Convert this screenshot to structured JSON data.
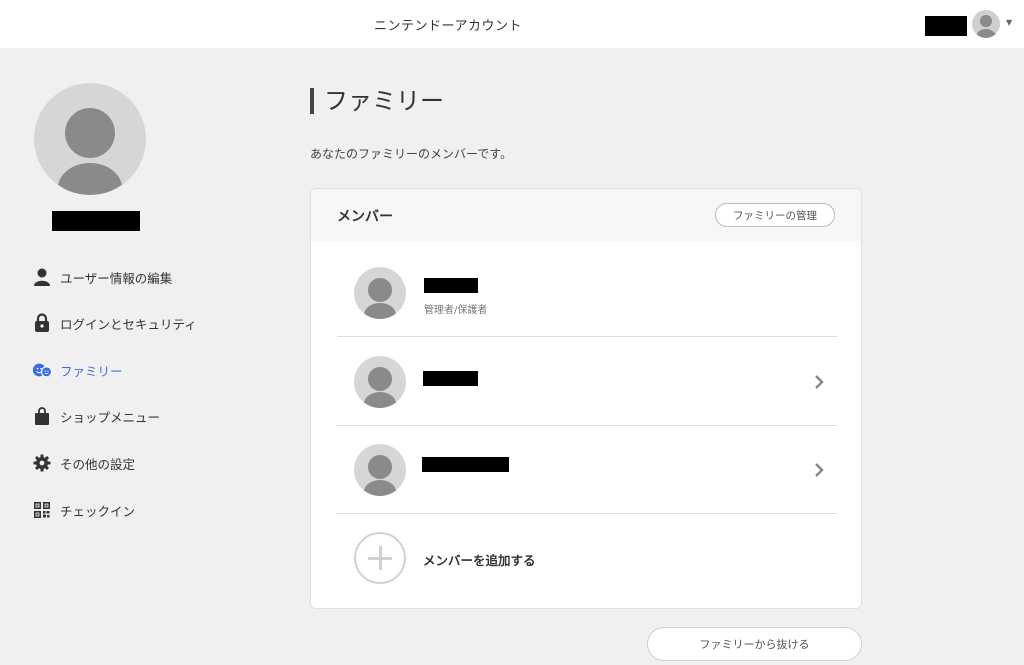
{
  "header": {
    "title": "ニンテンドーアカウント",
    "avatar_icon": "user-avatar-icon",
    "menu_icon": "caret-down-icon"
  },
  "sidebar": {
    "items": [
      {
        "label": "ユーザー情報の編集",
        "icon": "person-icon",
        "active": false
      },
      {
        "label": "ログインとセキュリティ",
        "icon": "lock-icon",
        "active": false
      },
      {
        "label": "ファミリー",
        "icon": "family-icon",
        "active": true
      },
      {
        "label": "ショップメニュー",
        "icon": "shopping-bag-icon",
        "active": false
      },
      {
        "label": "その他の設定",
        "icon": "gear-icon",
        "active": false
      },
      {
        "label": "チェックイン",
        "icon": "qr-code-icon",
        "active": false
      }
    ]
  },
  "main": {
    "title": "ファミリー",
    "description": "あなたのファミリーのメンバーです。",
    "card": {
      "header_title": "メンバー",
      "manage_button": "ファミリーの管理",
      "members": [
        {
          "role": "管理者/保護者"
        },
        {
          "role": ""
        },
        {
          "role": ""
        }
      ],
      "add_member": "メンバーを追加する"
    },
    "leave_button": "ファミリーから抜ける"
  },
  "colors": {
    "accent": "#3b6fd6",
    "background": "#f0f0f0"
  }
}
